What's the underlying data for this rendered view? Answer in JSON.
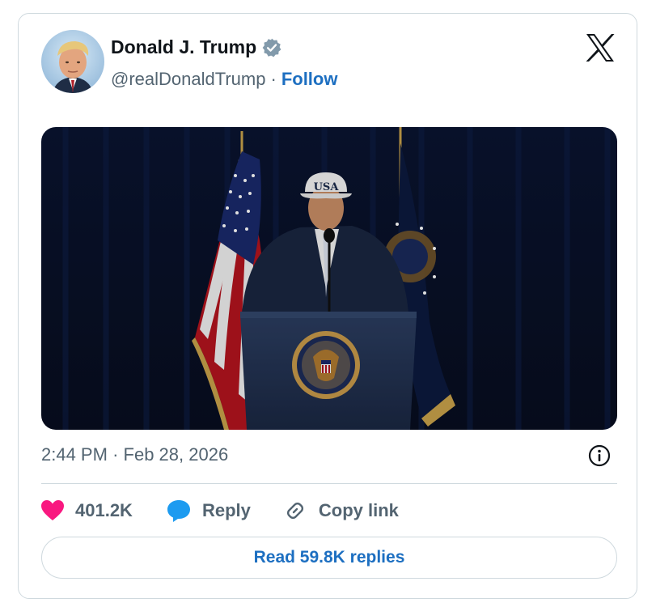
{
  "author": {
    "display_name": "Donald J. Trump",
    "handle": "@realDonaldTrump",
    "separator": "·",
    "follow_label": "Follow",
    "verified_icon": "verified-badge-icon"
  },
  "brand": {
    "logo_icon": "x-logo-icon"
  },
  "media": {
    "hat_text": "USA",
    "seal_label": "seal-of-the-president"
  },
  "meta": {
    "time": "2:44 PM",
    "separator": "·",
    "date": "Feb 28, 2026",
    "info_icon": "info-icon"
  },
  "actions": {
    "likes_count": "401.2K",
    "reply_label": "Reply",
    "copy_link_label": "Copy link"
  },
  "replies_button": {
    "label": "Read 59.8K replies"
  },
  "colors": {
    "accent": "#1d6fc1",
    "like": "#f91880",
    "reply_icon": "#1d9bf0",
    "muted_text": "#536471",
    "border": "#cfd9de"
  }
}
